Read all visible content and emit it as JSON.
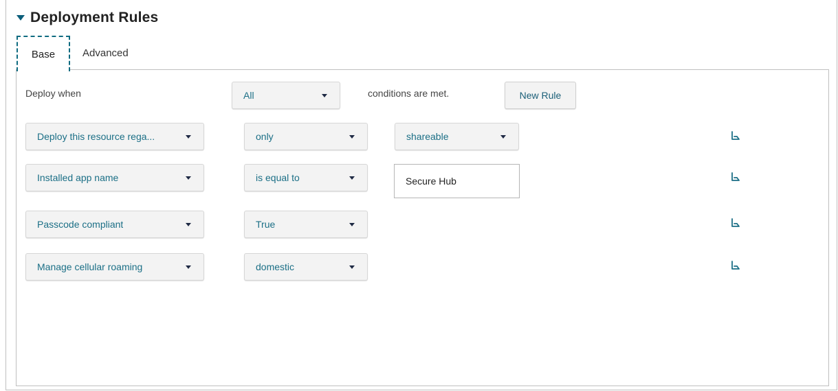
{
  "section": {
    "title": "Deployment Rules"
  },
  "tabs": [
    {
      "label": "Base"
    },
    {
      "label": "Advanced"
    }
  ],
  "header_row": {
    "deploy_when_label": "Deploy when",
    "match_select_value": "All",
    "conditions_label": "conditions are met.",
    "new_rule_label": "New Rule"
  },
  "rules": [
    {
      "property": "Deploy this resource rega...",
      "operator": "only",
      "value": "shareable",
      "value_type": "dropdown"
    },
    {
      "property": "Installed app name",
      "operator": "is equal to",
      "value": "Secure Hub",
      "value_type": "text"
    },
    {
      "property": "Passcode compliant",
      "operator": "True"
    },
    {
      "property": "Manage cellular roaming",
      "operator": "domestic"
    }
  ],
  "icons": {
    "section_toggle": "caret-down-icon",
    "dropdown": "chevron-down-icon",
    "delete": "delete-rule-icon"
  },
  "colors": {
    "accent": "#1b6f86",
    "dashed_focus": "#0e6b80"
  }
}
